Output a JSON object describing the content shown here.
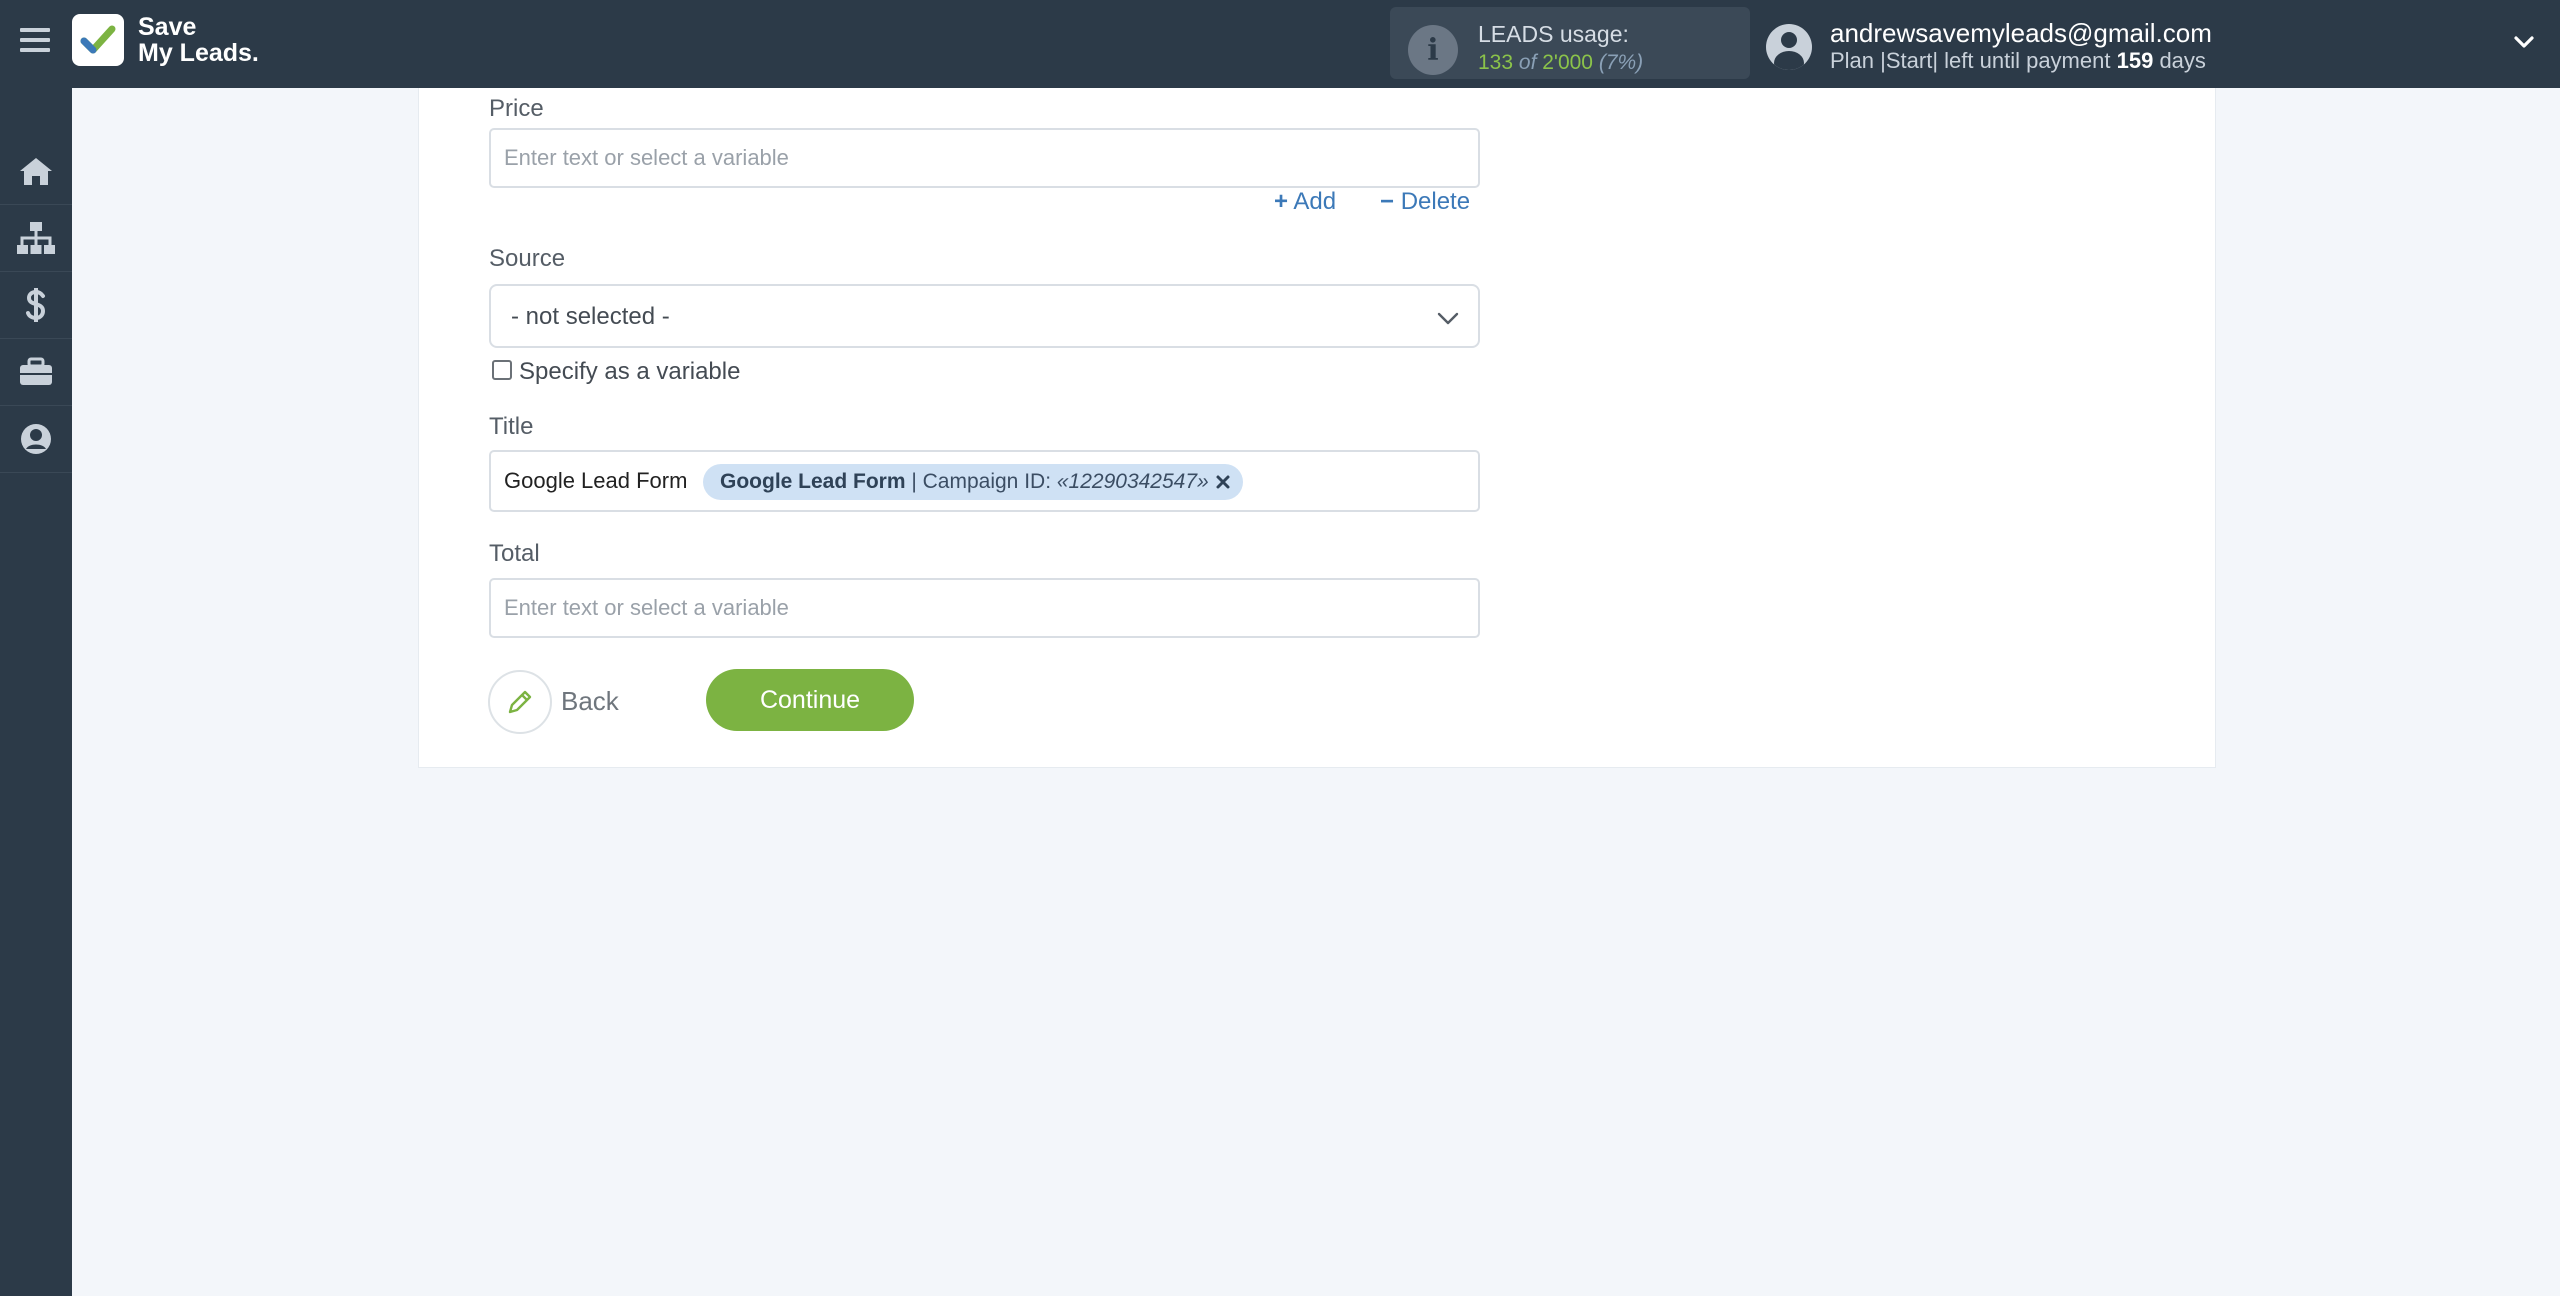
{
  "header": {
    "logo_line1": "Save",
    "logo_line2": "My Leads.",
    "usage": {
      "title": "LEADS usage:",
      "count": "133",
      "of": "of",
      "limit": "2'000",
      "percent": "(7%)"
    },
    "account": {
      "email": "andrewsavemyleads@gmail.com",
      "plan_prefix": "Plan |Start| left until payment",
      "days": "159",
      "days_suffix": "days"
    }
  },
  "sidebar": {
    "items": [
      {
        "icon": "home-icon"
      },
      {
        "icon": "sitemap-icon"
      },
      {
        "icon": "dollar-icon"
      },
      {
        "icon": "briefcase-icon"
      },
      {
        "icon": "user-circle-icon"
      }
    ]
  },
  "form": {
    "price": {
      "label": "Price",
      "placeholder": "Enter text or select a variable"
    },
    "add_label": "Add",
    "delete_label": "Delete",
    "source": {
      "label": "Source",
      "selected": "- not selected -"
    },
    "specify_variable_label": "Specify as a variable",
    "title": {
      "label": "Title",
      "text": "Google Lead Form",
      "chip_bold": "Google Lead Form",
      "chip_middle": " | Campaign ID: ",
      "chip_value": "«12290342547»"
    },
    "total": {
      "label": "Total",
      "placeholder": "Enter text or select a variable"
    },
    "back_label": "Back",
    "continue_label": "Continue"
  },
  "colors": {
    "topbar": "#2c3a48",
    "accent_green": "#7cb342",
    "link_blue": "#3c79b8",
    "chip_bg": "#cfe1f4"
  }
}
